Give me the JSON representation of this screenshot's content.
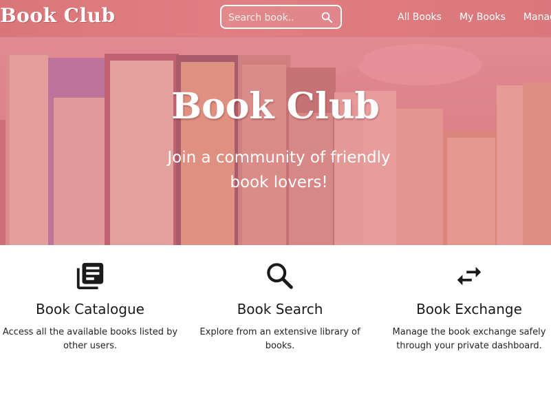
{
  "navbar": {
    "brand": "Book Club",
    "search_placeholder": "Search book..",
    "links": [
      "All Books",
      "My Books",
      "Manage"
    ]
  },
  "hero": {
    "title": "Book Club",
    "subtitle": "Join a community of friendly book lovers!"
  },
  "features": [
    {
      "icon": "library-books-icon",
      "title": "Book Catalogue",
      "description": "Access all the available books listed by other users."
    },
    {
      "icon": "search-icon",
      "title": "Book Search",
      "description": "Explore from an extensive library of books."
    },
    {
      "icon": "swap-arrows-icon",
      "title": "Book Exchange",
      "description": "Manage the book exchange safely through your private dashboard."
    }
  ],
  "colors": {
    "navbar": "#de7a7e",
    "overlay": "#de767a",
    "text": "#1a1a1a"
  }
}
